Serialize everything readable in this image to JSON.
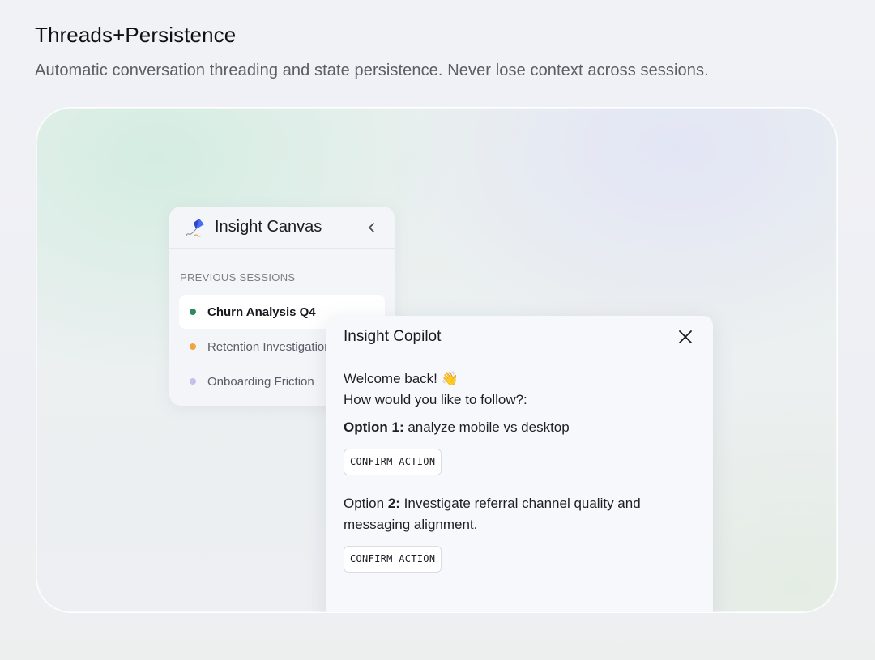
{
  "header": {
    "title": "Threads+Persistence",
    "subtitle": "Automatic conversation threading and state persistence. Never lose context across sessions."
  },
  "sidebar": {
    "app_name": "Insight Canvas",
    "logo_icon": "kite-icon",
    "collapse_icon": "chevron-left-icon",
    "section_label": "PREVIOUS SESSIONS",
    "sessions": [
      {
        "label": "Churn Analysis Q4",
        "dot_color": "#2e8a5e",
        "active": true
      },
      {
        "label": "Retention Investigation",
        "dot_color": "#f0a640",
        "active": false
      },
      {
        "label": "Onboarding Friction",
        "dot_color": "#c6bff0",
        "active": false
      }
    ]
  },
  "copilot": {
    "title": "Insight Copilot",
    "close_icon": "close-icon",
    "greeting": "Welcome back! 👋",
    "question": "How would you like to follow?:",
    "option1": {
      "label": "Option 1:",
      "text": " analyze mobile vs desktop",
      "button": "CONFIRM ACTION"
    },
    "option2": {
      "label_prefix": "Option ",
      "label_num": "2:",
      "text": " Investigate referral channel quality and messaging alignment.",
      "button": "CONFIRM ACTION"
    }
  }
}
